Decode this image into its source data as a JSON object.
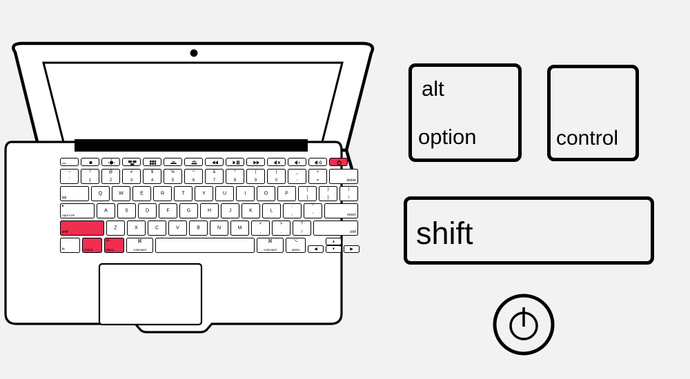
{
  "page": {
    "title": "Mac keyboard modifier keys diagram",
    "background_color": "#f2f2f2",
    "ink_color": "#000000",
    "highlight_color": "#ef2e50",
    "key_face_color": "#ffffff"
  },
  "callouts": {
    "alt_option": {
      "top_label": "alt",
      "bottom_label": "option",
      "name": "alt-option-key"
    },
    "control": {
      "label": "control",
      "name": "control-key"
    },
    "shift": {
      "label": "shift",
      "name": "shift-key"
    },
    "power": {
      "name": "power-button",
      "icon": "power-icon"
    }
  },
  "laptop": {
    "name": "macbook-air-illustration",
    "camera": "camera-dot",
    "screen": "display-panel",
    "hinge": "hinge-bar",
    "trackpad": "trackpad",
    "highlighted_keys": [
      "esc-power",
      "shift-left",
      "control",
      "alt-option"
    ]
  },
  "keyboard": {
    "function_row": [
      {
        "id": "f-esc",
        "label": "esc",
        "icon": "",
        "highlight": false
      },
      {
        "id": "f1",
        "label": "",
        "icon": "brightness-down-icon",
        "highlight": false
      },
      {
        "id": "f2",
        "label": "",
        "icon": "brightness-up-icon",
        "highlight": false
      },
      {
        "id": "f3",
        "label": "",
        "icon": "mission-control-icon",
        "highlight": false
      },
      {
        "id": "f4",
        "label": "",
        "icon": "launchpad-icon",
        "highlight": false
      },
      {
        "id": "f5",
        "label": "",
        "icon": "keyboard-brightness-down-icon",
        "highlight": false
      },
      {
        "id": "f6",
        "label": "",
        "icon": "keyboard-brightness-up-icon",
        "highlight": false
      },
      {
        "id": "f7",
        "label": "",
        "icon": "rewind-icon",
        "highlight": false
      },
      {
        "id": "f8",
        "label": "",
        "icon": "play-pause-icon",
        "highlight": false
      },
      {
        "id": "f9",
        "label": "",
        "icon": "fast-forward-icon",
        "highlight": false
      },
      {
        "id": "f10",
        "label": "",
        "icon": "mute-icon",
        "highlight": false
      },
      {
        "id": "f11",
        "label": "",
        "icon": "volume-down-icon",
        "highlight": false
      },
      {
        "id": "f12",
        "label": "",
        "icon": "volume-up-icon",
        "highlight": false
      },
      {
        "id": "f-power",
        "label": "",
        "icon": "power-icon",
        "highlight": true
      }
    ],
    "number_row": [
      {
        "id": "n-tilde",
        "top": "~",
        "bottom": "`"
      },
      {
        "id": "n-1",
        "top": "!",
        "bottom": "1"
      },
      {
        "id": "n-2",
        "top": "@",
        "bottom": "2"
      },
      {
        "id": "n-3",
        "top": "#",
        "bottom": "3"
      },
      {
        "id": "n-4",
        "top": "$",
        "bottom": "4"
      },
      {
        "id": "n-5",
        "top": "%",
        "bottom": "5"
      },
      {
        "id": "n-6",
        "top": "^",
        "bottom": "6"
      },
      {
        "id": "n-7",
        "top": "&",
        "bottom": "7"
      },
      {
        "id": "n-8",
        "top": "*",
        "bottom": "8"
      },
      {
        "id": "n-9",
        "top": "(",
        "bottom": "9"
      },
      {
        "id": "n-0",
        "top": ")",
        "bottom": "0"
      },
      {
        "id": "n-minus",
        "top": "_",
        "bottom": "-"
      },
      {
        "id": "n-equal",
        "top": "+",
        "bottom": "="
      }
    ],
    "delete_key": "delete",
    "top_letter_row": {
      "tab": "tab",
      "letters": [
        "Q",
        "W",
        "E",
        "R",
        "T",
        "Y",
        "U",
        "I",
        "O",
        "P"
      ],
      "bracket_left": {
        "top": "{",
        "bottom": "["
      },
      "bracket_right": {
        "top": "}",
        "bottom": "]"
      },
      "backslash": {
        "top": "|",
        "bottom": "\\"
      }
    },
    "home_row": {
      "caps_lock": "caps lock",
      "letters": [
        "A",
        "S",
        "D",
        "F",
        "G",
        "H",
        "J",
        "K",
        "L"
      ],
      "semicolon": {
        "top": ":",
        "bottom": ";"
      },
      "quote": {
        "top": "\"",
        "bottom": "'"
      },
      "return": "return"
    },
    "bottom_letter_row": {
      "shift_left": "shift",
      "letters": [
        "Z",
        "X",
        "C",
        "V",
        "B",
        "N",
        "M"
      ],
      "comma": {
        "top": "<",
        "bottom": ","
      },
      "period": {
        "top": ">",
        "bottom": "."
      },
      "slash": {
        "top": "?",
        "bottom": "/"
      },
      "shift_right": "shift"
    },
    "modifier_row": {
      "fn": "fn",
      "control": "control",
      "option_left": {
        "top": "alt",
        "bottom": "option"
      },
      "command_left": "command",
      "space": "",
      "command_right": "command",
      "option_right": {
        "top": "alt",
        "bottom": "option"
      },
      "arrow_left": "left-arrow-icon",
      "arrow_up": "up-arrow-icon",
      "arrow_down": "down-arrow-icon",
      "arrow_right": "right-arrow-icon"
    }
  }
}
